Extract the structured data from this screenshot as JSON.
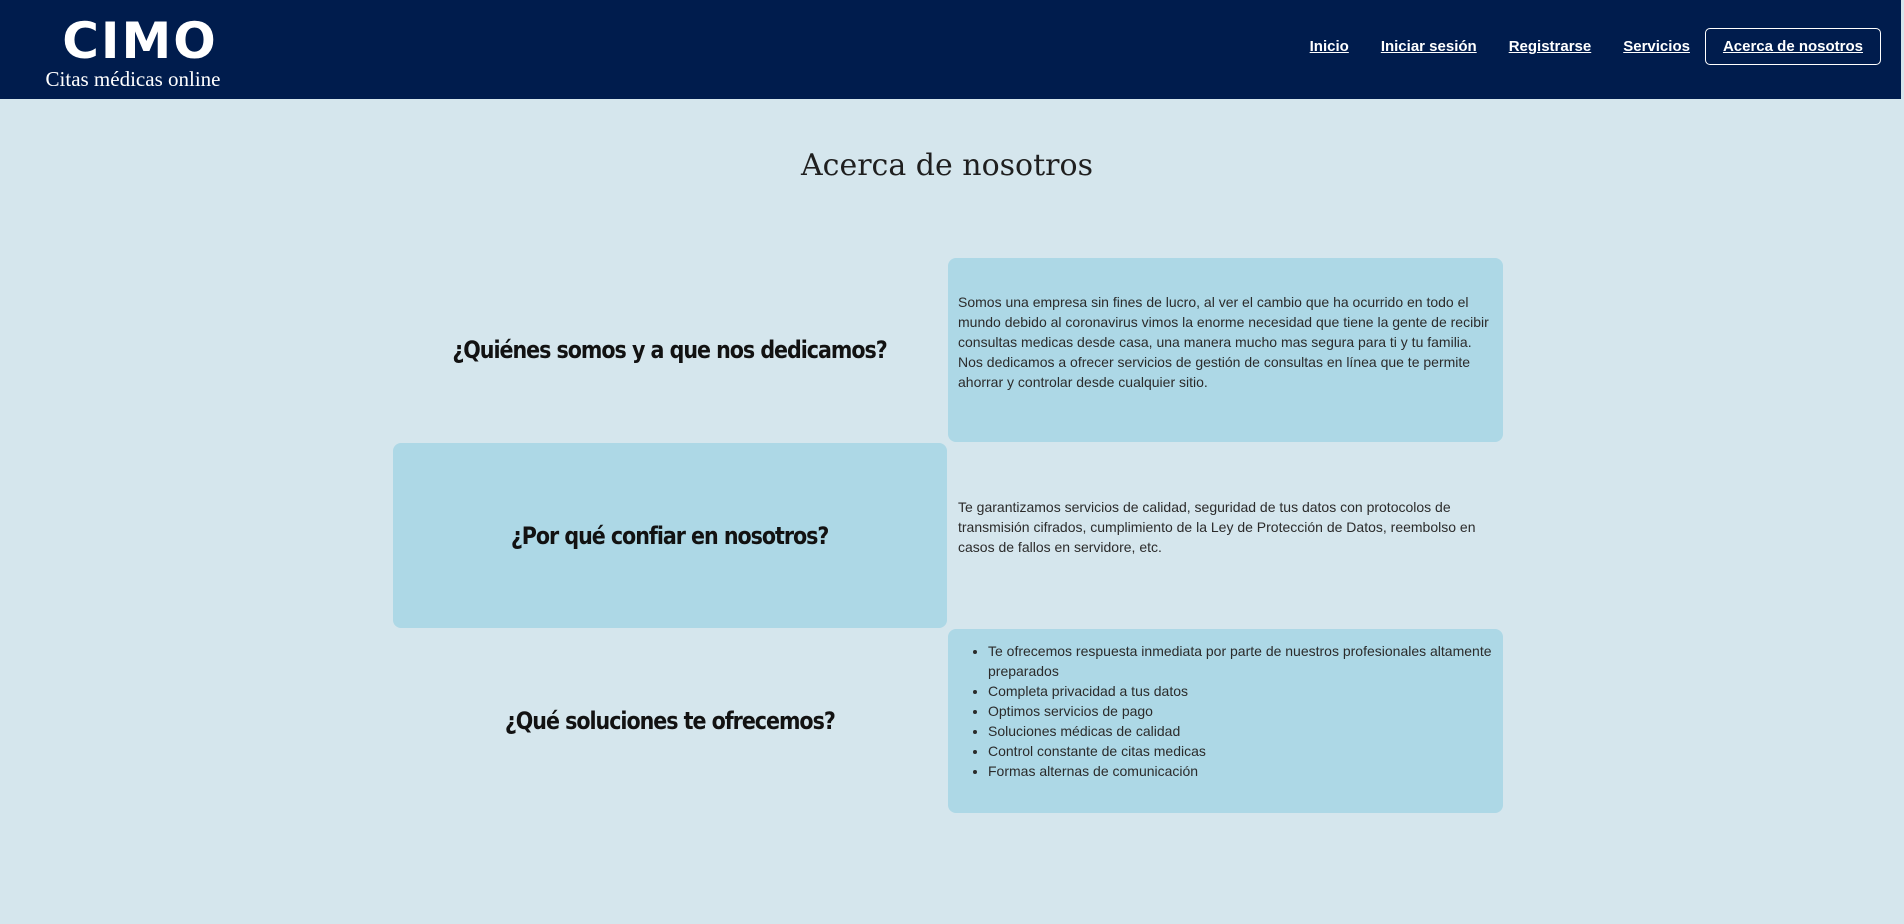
{
  "brand": {
    "name": "CIMO",
    "tagline": "Citas médicas online"
  },
  "nav": {
    "items": [
      {
        "label": "Inicio"
      },
      {
        "label": "Iniciar sesión"
      },
      {
        "label": "Registrarse"
      },
      {
        "label": "Servicios"
      },
      {
        "label": "Acerca de nosotros",
        "active": true
      }
    ]
  },
  "page": {
    "title": "Acerca de nosotros"
  },
  "sections": {
    "who": {
      "heading": "¿Quiénes somos y a que nos dedicamos?",
      "text": "Somos una empresa sin fines de lucro, al ver el cambio que ha ocurrido en todo el mundo debido al coronavirus vimos la enorme necesidad que tiene la gente de recibir consultas medicas desde casa, una manera mucho mas segura para ti y tu familia. Nos dedicamos a ofrecer servicios de gestión de consultas en línea que te permite ahorrar y controlar desde cualquier sitio."
    },
    "trust": {
      "heading": "¿Por qué confiar en nosotros?",
      "text": "Te garantizamos servicios de calidad, seguridad de tus datos con protocolos de transmisión cifrados, cumplimiento de la Ley de Protección de Datos, reembolso en casos de fallos en servidore, etc."
    },
    "solutions": {
      "heading": "¿Qué soluciones te ofrecemos?",
      "items": [
        "Te ofrecemos respuesta inmediata por parte de nuestros profesionales altamente preparados",
        "Completa privacidad a tus datos",
        "Optimos servicios de pago",
        "Soluciones médicas de calidad",
        "Control constante de citas medicas",
        "Formas alternas de comunicación"
      ]
    }
  },
  "colors": {
    "navbar": "#001c4d",
    "page_background": "#d5e6ed",
    "card_background": "#add8e6"
  }
}
